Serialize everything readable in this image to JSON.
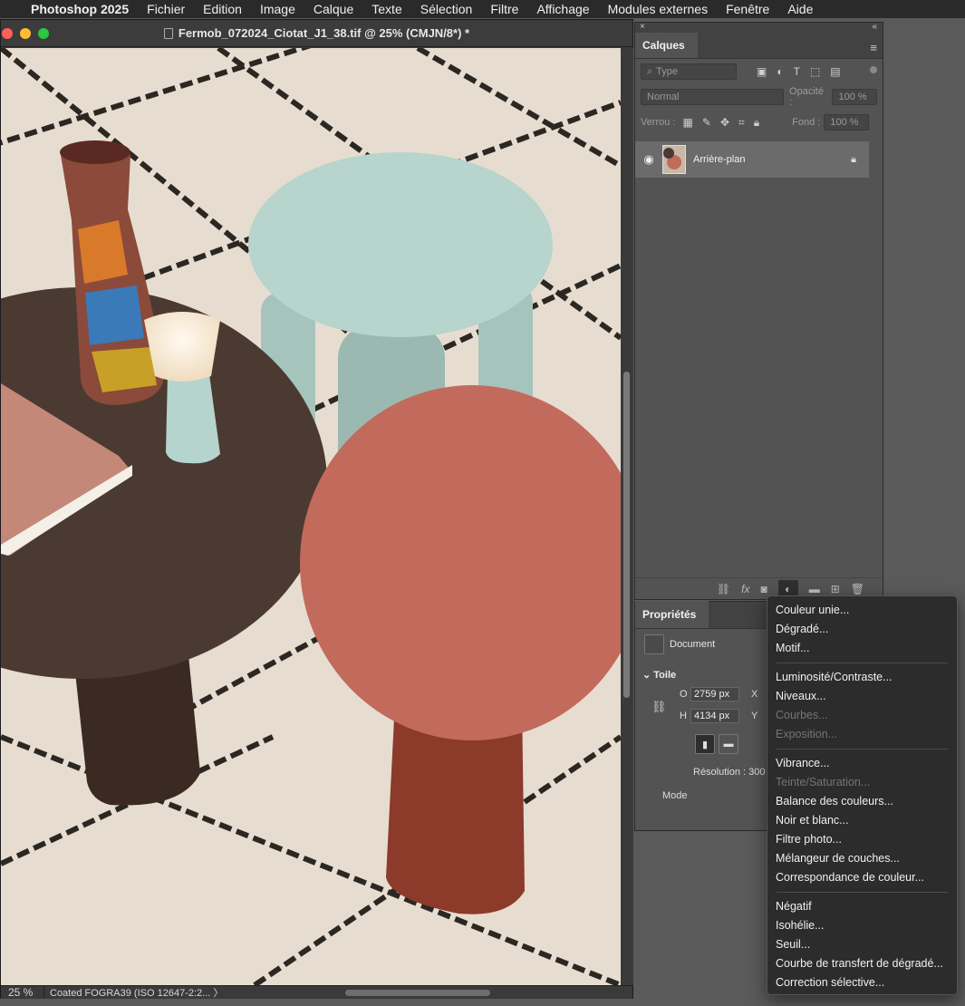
{
  "menubar": {
    "app": "Photoshop 2025",
    "items": [
      "Fichier",
      "Edition",
      "Image",
      "Calque",
      "Texte",
      "Sélection",
      "Filtre",
      "Affichage",
      "Modules externes",
      "Fenêtre",
      "Aide"
    ]
  },
  "document": {
    "title": "Fermob_072024_Ciotat_J1_38.tif @ 25% (CMJN/8*) *",
    "zoom": "25 %",
    "profile": "Coated FOGRA39 (ISO 12647-2:2... 〉"
  },
  "layers_panel": {
    "tab": "Calques",
    "filter_placeholder": "Type",
    "blend_mode": "Normal",
    "opacity_label": "Opacité :",
    "opacity_value": "100 %",
    "lock_label": "Verrou :",
    "fill_label": "Fond :",
    "fill_value": "100 %",
    "layer_name": "Arrière-plan"
  },
  "properties_panel": {
    "tab": "Propriétés",
    "section": "Document",
    "canvas_label": "Toile",
    "width_label": "O",
    "width_value": "2759 px",
    "height_label": "H",
    "height_value": "4134 px",
    "x_label": "X",
    "y_label": "Y",
    "resolution": "Résolution : 300",
    "mode_label": "Mode"
  },
  "adjustment_menu": {
    "groups": [
      [
        {
          "label": "Couleur unie...",
          "enabled": true
        },
        {
          "label": "Dégradé...",
          "enabled": true
        },
        {
          "label": "Motif...",
          "enabled": true
        }
      ],
      [
        {
          "label": "Luminosité/Contraste...",
          "enabled": true
        },
        {
          "label": "Niveaux...",
          "enabled": true
        },
        {
          "label": "Courbes...",
          "enabled": false
        },
        {
          "label": "Exposition...",
          "enabled": false
        }
      ],
      [
        {
          "label": "Vibrance...",
          "enabled": true
        },
        {
          "label": "Teinte/Saturation...",
          "enabled": false
        },
        {
          "label": "Balance des couleurs...",
          "enabled": true
        },
        {
          "label": "Noir et blanc...",
          "enabled": true
        },
        {
          "label": "Filtre photo...",
          "enabled": true
        },
        {
          "label": "Mélangeur de couches...",
          "enabled": true
        },
        {
          "label": "Correspondance de couleur...",
          "enabled": true
        }
      ],
      [
        {
          "label": "Négatif",
          "enabled": true
        },
        {
          "label": "Isohélie...",
          "enabled": true
        },
        {
          "label": "Seuil...",
          "enabled": true
        },
        {
          "label": "Courbe de transfert de dégradé...",
          "enabled": true
        },
        {
          "label": "Correction sélective...",
          "enabled": true
        }
      ]
    ]
  },
  "colors": {
    "menu_bg": "#2c2c2c",
    "panel_bg": "#535353",
    "table_dark": "#4a3a32",
    "table_terracotta": "#c26a5c",
    "table_mint": "#b7d4cd"
  }
}
